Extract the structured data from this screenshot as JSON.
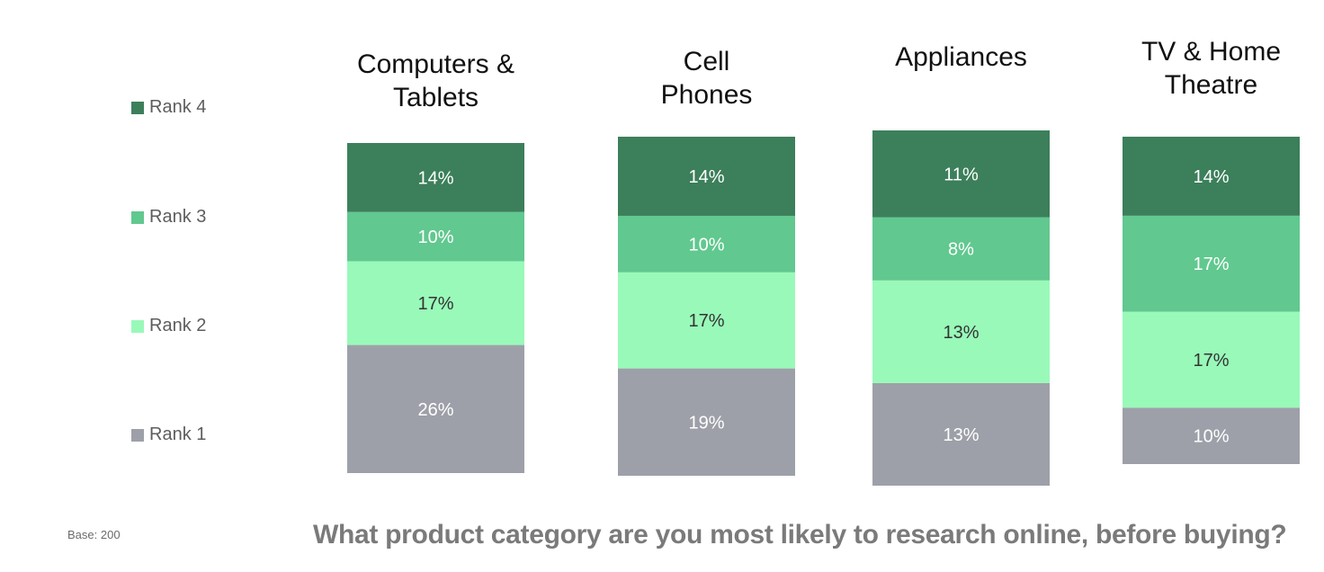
{
  "chart_data": {
    "type": "bar",
    "stacked": true,
    "title": "What product category are you most likely to research online, before buying?",
    "footnote": "Base: 200",
    "categories": [
      "Computers &\nTablets",
      "Cell\nPhones",
      "Appliances",
      "TV & Home\nTheatre"
    ],
    "series": [
      {
        "name": "Rank 1",
        "color": "#9da0a8",
        "label_color": "#ffffff",
        "values": [
          26,
          19,
          13,
          10
        ]
      },
      {
        "name": "Rank 2",
        "color": "#99f9b9",
        "label_color": "#333333",
        "values": [
          17,
          17,
          13,
          17
        ]
      },
      {
        "name": "Rank 3",
        "color": "#61c88f",
        "label_color": "#ffffff",
        "values": [
          10,
          10,
          8,
          17
        ]
      },
      {
        "name": "Rank 4",
        "color": "#3c7f5b",
        "label_color": "#ffffff",
        "values": [
          14,
          14,
          11,
          14
        ]
      }
    ],
    "value_format": "{v}%",
    "legend": {
      "placement": "left",
      "order": [
        "Rank 4",
        "Rank 3",
        "Rank 2",
        "Rank 1"
      ]
    },
    "xlabel": "",
    "ylabel": "",
    "grid": false,
    "axes_visible": false
  }
}
